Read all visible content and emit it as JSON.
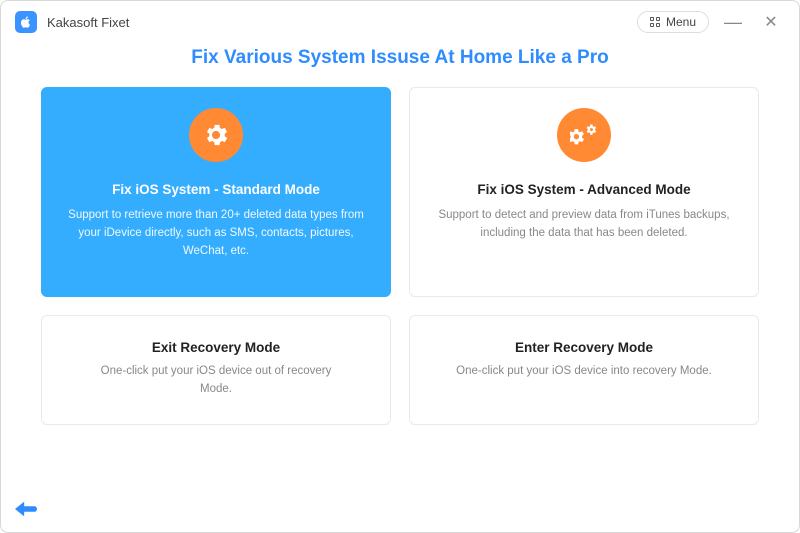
{
  "app": {
    "name": "Kakasoft Fixet",
    "menu_label": "Menu"
  },
  "headline": "Fix Various System Issuse At Home Like a Pro",
  "cards": {
    "standard": {
      "title": "Fix iOS System - Standard Mode",
      "desc": "Support to retrieve more than 20+ deleted data types from your iDevice directly, such as SMS, contacts, pictures, WeChat, etc."
    },
    "advanced": {
      "title": "Fix iOS System - Advanced Mode",
      "desc": "Support to detect and preview data from iTunes backups, including the data that has been deleted."
    },
    "exit_recovery": {
      "title": "Exit Recovery Mode",
      "desc": "One-click put your iOS device out of recovery Mode."
    },
    "enter_recovery": {
      "title": "Enter Recovery Mode",
      "desc": "One-click put your iOS device into recovery Mode."
    }
  }
}
